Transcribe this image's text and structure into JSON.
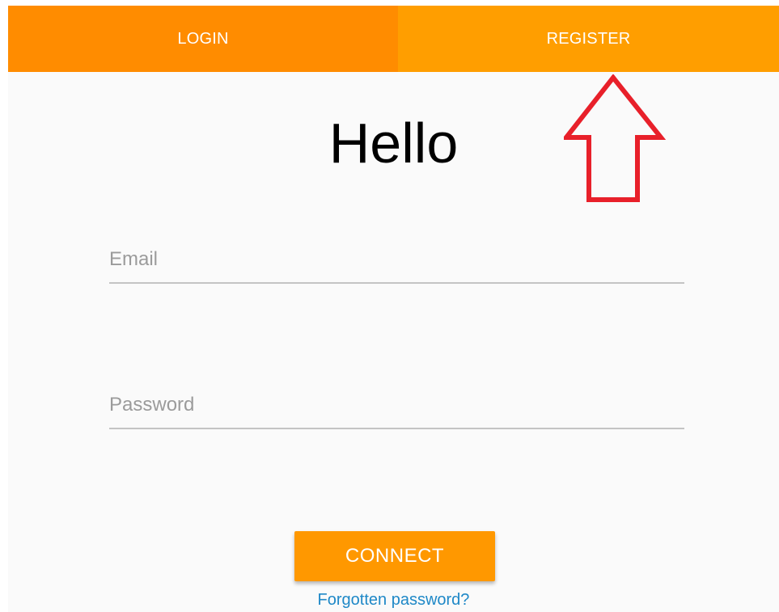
{
  "tabs": {
    "login": "LOGIN",
    "register": "REGISTER"
  },
  "title": "Hello",
  "form": {
    "email_placeholder": "Email",
    "email_value": "",
    "password_placeholder": "Password",
    "password_value": ""
  },
  "actions": {
    "connect_label": "CONNECT",
    "forgot_label": "Forgotten password?"
  },
  "colors": {
    "tab_login_bg": "#ff8c00",
    "tab_register_bg": "#ff9e00",
    "button_bg": "#ff9800",
    "link": "#1e88c7",
    "annotation_arrow": "#e8202a"
  },
  "icons": {
    "annotation": "arrow-up-icon"
  }
}
